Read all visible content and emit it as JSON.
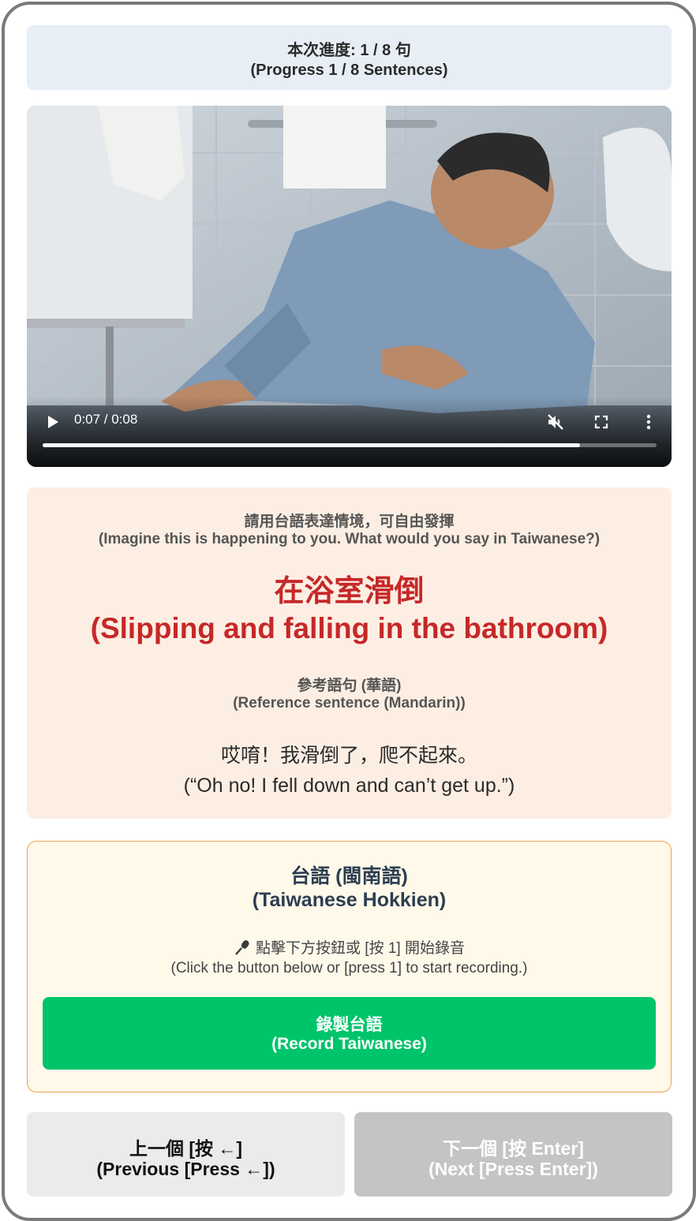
{
  "progress": {
    "line1": "本次進度: 1 / 8 句",
    "line2": "(Progress 1 / 8 Sentences)"
  },
  "video": {
    "time": "0:07 / 0:08",
    "played_fraction": 0.875,
    "muted": true,
    "icons": [
      "play-icon",
      "muted-speaker-icon",
      "fullscreen-icon",
      "more-vertical-icon"
    ]
  },
  "prompt": {
    "instruction_zh": "請用台語表達情境，可自由發揮",
    "instruction_en": "(Imagine this is happening to you. What would you say in Taiwanese?)",
    "title_zh": "在浴室滑倒",
    "title_en": "(Slipping and falling in the bathroom)",
    "reference_label_zh": "參考語句 (華語)",
    "reference_label_en": "(Reference sentence (Mandarin))",
    "sentence_zh": "哎唷！我滑倒了，爬不起來。",
    "sentence_en": "(“Oh no! I fell down and can’t get up.”)",
    "accent_color": "#c62828"
  },
  "recording": {
    "heading_zh": "台語 (閩南語)",
    "heading_en": "(Taiwanese Hokkien)",
    "hint_zh": "點擊下方按鈕或 [按 1] 開始錄音",
    "hint_en": "(Click the button below or [press 1] to start recording.)",
    "hint_icon": "microphone-icon",
    "button_zh": "錄製台語",
    "button_en": "(Record Taiwanese)",
    "button_color": "#00c46a"
  },
  "navigation": {
    "prev_zh": "上一個 [按 ←]",
    "prev_en": "(Previous [Press ←])",
    "next_zh": "下一個 [按 Enter]",
    "next_en": "(Next [Press Enter])",
    "next_disabled": true
  }
}
